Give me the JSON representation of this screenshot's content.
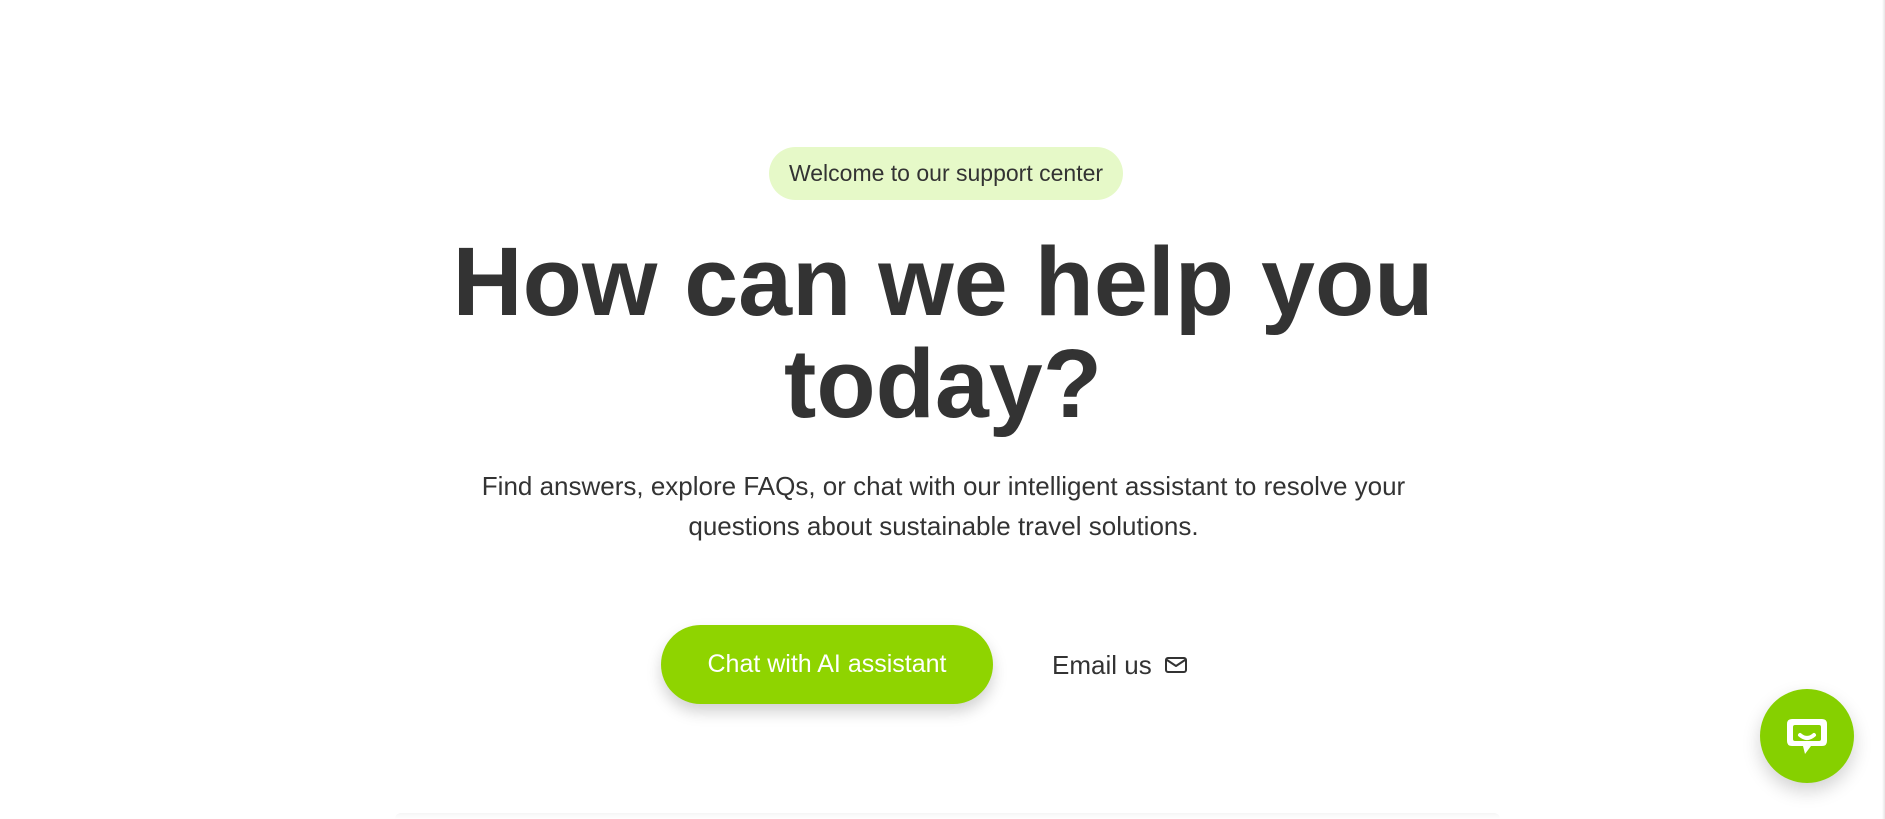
{
  "hero": {
    "badge": "Welcome to our support center",
    "title": "How can we help you today?",
    "subtitle": "Find answers, explore FAQs, or chat with our intelligent assistant to resolve your questions about sustainable travel solutions.",
    "primary_cta": "Chat with AI assistant",
    "secondary_cta": "Email us"
  },
  "icons": {
    "email": "mail-icon",
    "chat": "chat-bubble-icon"
  },
  "colors": {
    "accent": "#8fd400",
    "badge_background": "#e6f9c8",
    "text": "#333333",
    "background": "#ffffff"
  }
}
